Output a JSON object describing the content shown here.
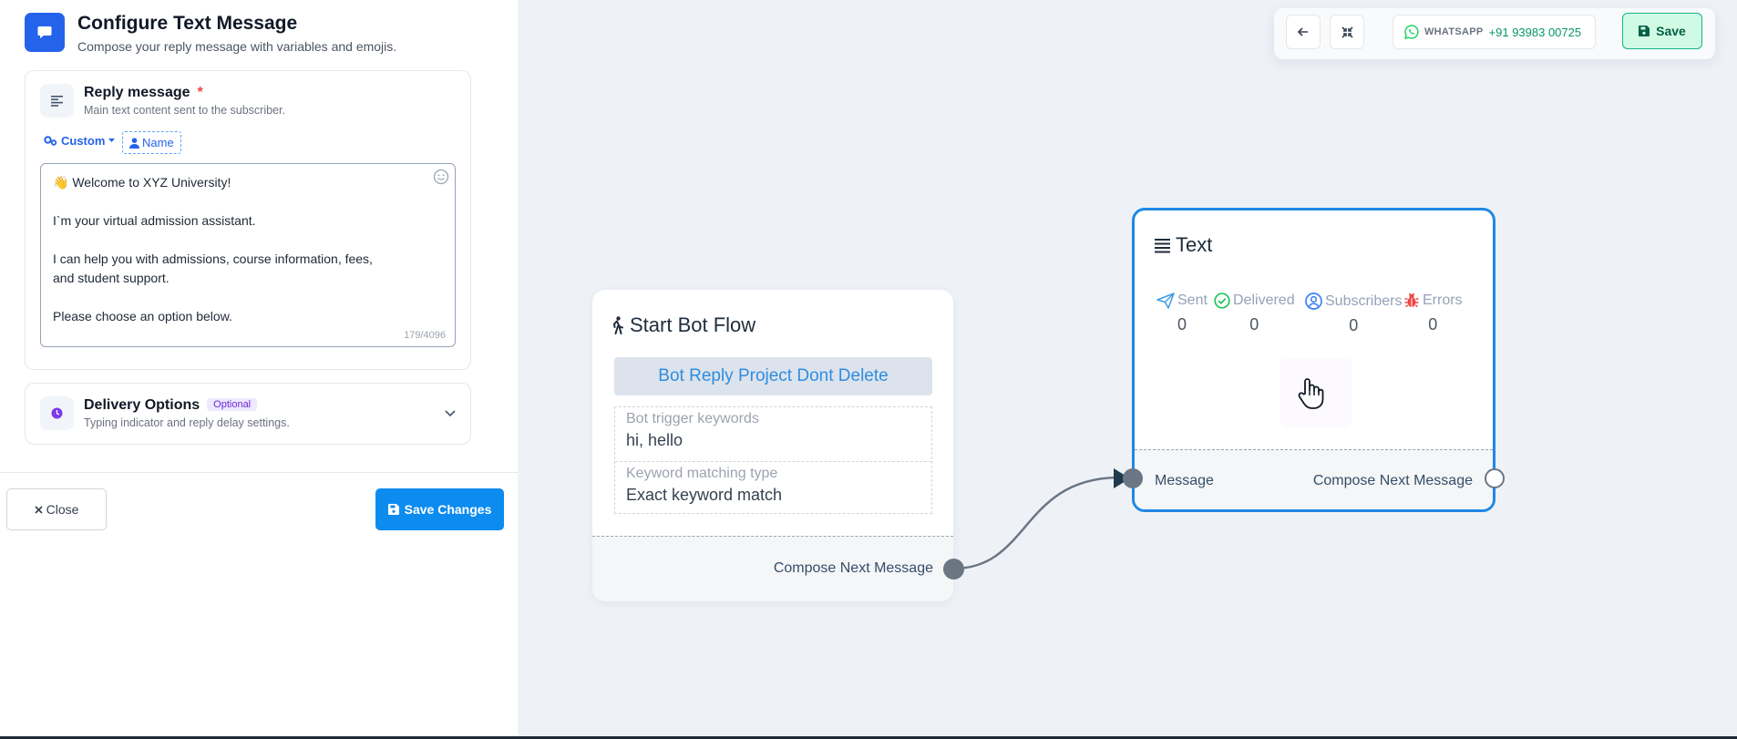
{
  "header": {
    "title": "Configure Text Message",
    "subtitle": "Compose your reply message with variables and emojis."
  },
  "reply": {
    "title": "Reply message",
    "required_mark": "*",
    "subtitle": "Main text content sent to the subscriber.",
    "var_custom": "Custom",
    "var_name": "Name",
    "message": "👋 Welcome to XYZ University!\n\nI`m your virtual admission assistant.\n\nI can help you with admissions, course information, fees,\nand student support.\n\nPlease choose an option below.",
    "counter": "179/4096"
  },
  "delivery": {
    "title": "Delivery Options",
    "badge": "Optional",
    "subtitle": "Typing indicator and reply delay settings."
  },
  "footer": {
    "close_label": "Close",
    "save_label": "Save Changes"
  },
  "toolbar": {
    "channel_label": "WHATSAPP",
    "channel_number": "+91 93983 00725",
    "save_label": "Save"
  },
  "start_node": {
    "title": "Start Bot Flow",
    "project": "Bot Reply Project Dont Delete",
    "keywords_label": "Bot trigger keywords",
    "keywords_value": "hi, hello",
    "matching_label": "Keyword matching type",
    "matching_value": "Exact keyword match",
    "output_label": "Compose Next Message"
  },
  "text_node": {
    "title": "Text",
    "stats": [
      {
        "label": "Sent",
        "value": "0"
      },
      {
        "label": "Delivered",
        "value": "0"
      },
      {
        "label": "Subscribers",
        "value": "0"
      },
      {
        "label": "Errors",
        "value": "0"
      }
    ],
    "input_label": "Message",
    "output_label": "Compose Next Message"
  },
  "colors": {
    "primary": "#2563eb",
    "save_button": "#0d8cf0",
    "node_border": "#1e88e5",
    "whatsapp": "#25d366",
    "success": "#10b981",
    "error": "#ef4444"
  },
  "icons": [
    "chat-icon",
    "align-left-icon",
    "gears-icon",
    "user-icon",
    "smile-icon",
    "clock-icon",
    "chevron-down-icon",
    "close-icon",
    "floppy-icon",
    "arrow-left-icon",
    "compress-icon",
    "whatsapp-icon",
    "walking-person-icon",
    "list-icon",
    "paper-plane-icon",
    "check-circle-icon",
    "user-circle-icon",
    "bug-icon",
    "hand-cursor-icon"
  ]
}
